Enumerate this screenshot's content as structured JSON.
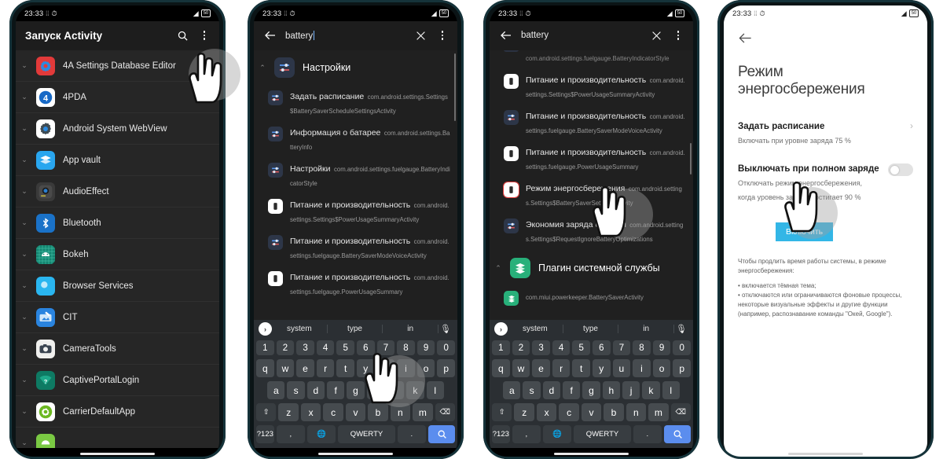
{
  "statusbar": {
    "time": "23:33",
    "vibrate_icon": "vibrate-icon",
    "alarm_icon": "alarm-icon",
    "signal_icon": "signal-icon",
    "battery_text": "50"
  },
  "panel1": {
    "title": "Запуск Activity",
    "search_icon": "search-icon",
    "overflow_icon": "overflow-menu-icon",
    "apps": [
      {
        "label": "4A Settings Database Editor",
        "icon": "gear-app-icon"
      },
      {
        "label": "4PDA",
        "icon": "4pda-app-icon"
      },
      {
        "label": "Android System WebView",
        "icon": "webview-app-icon"
      },
      {
        "label": "App vault",
        "icon": "app-vault-icon"
      },
      {
        "label": "AudioEffect",
        "icon": "audio-effect-icon"
      },
      {
        "label": "Bluetooth",
        "icon": "bluetooth-icon"
      },
      {
        "label": "Bokeh",
        "icon": "bokeh-icon"
      },
      {
        "label": "Browser Services",
        "icon": "browser-services-icon"
      },
      {
        "label": "CIT",
        "icon": "cit-icon"
      },
      {
        "label": "CameraTools",
        "icon": "camera-tools-icon"
      },
      {
        "label": "CaptivePortalLogin",
        "icon": "captive-portal-icon"
      },
      {
        "label": "CarrierDefaultApp",
        "icon": "carrier-default-icon"
      }
    ]
  },
  "panel2": {
    "back_icon": "back-arrow-icon",
    "query": "battery",
    "clear_icon": "clear-x-icon",
    "overflow_icon": "overflow-menu-icon",
    "group": {
      "label": "Настройки",
      "icon": "settings-app-icon"
    },
    "results": [
      {
        "name": "Задать расписание",
        "pkg": "com.android.settings.Settings$BatterySaverScheduleSettingsActivity",
        "icon": "settings-sliders-icon"
      },
      {
        "name": "Информация о батарее",
        "pkg": "com.android.settings.BatteryInfo",
        "icon": "settings-sliders-icon"
      },
      {
        "name": "Настройки",
        "pkg": "com.android.settings.fuelgauge.BatteryIndicatorStyle",
        "icon": "settings-sliders-icon"
      },
      {
        "name": "Питание и производительность",
        "pkg": "com.android.settings.Settings$PowerUsageSummaryActivity",
        "icon": "battery-icon"
      },
      {
        "name": "Питание и производительность",
        "pkg": "com.android.settings.fuelgauge.BatterySaverModeVoiceActivity",
        "icon": "settings-sliders-icon"
      },
      {
        "name": "Питание и производительность",
        "pkg": "com.android.settings.fuelgauge.PowerUsageSummary",
        "icon": "battery-icon"
      }
    ]
  },
  "panel3": {
    "back_icon": "back-arrow-icon",
    "query": "battery",
    "clear_icon": "clear-x-icon",
    "overflow_icon": "overflow-menu-icon",
    "top_partial_pkg": "com.android.settings.fuelgauge.BatteryIndicatorStyle",
    "results": [
      {
        "name": "Питание и производительность",
        "pkg": "com.android.settings.Settings$PowerUsageSummaryActivity",
        "icon": "battery-icon",
        "highlight": false
      },
      {
        "name": "Питание и производительность",
        "pkg": "com.android.settings.fuelgauge.BatterySaverModeVoiceActivity",
        "icon": "settings-sliders-icon",
        "highlight": false
      },
      {
        "name": "Питание и производительность",
        "pkg": "com.android.settings.fuelgauge.PowerUsageSummary",
        "icon": "battery-icon",
        "highlight": false
      },
      {
        "name": "Режим энергосбережения",
        "pkg": "com.android.settings.Settings$BatterySaverSettingsActivity",
        "icon": "battery-icon",
        "highlight": true
      },
      {
        "name": "Экономия заряда батареи",
        "pkg": "com.android.settings.Settings$RequestIgnoreBatteryOptimizations",
        "icon": "settings-sliders-icon",
        "highlight": false
      }
    ],
    "group2": {
      "label": "Плагин системной службы",
      "icon": "plugin-stack-icon"
    },
    "group2_item_pkg": "com.miui.powerkeeper.BatterySaverActivity"
  },
  "panel4": {
    "back_icon": "back-arrow-icon",
    "title": "Режим энергосбережения",
    "schedule": {
      "title": "Задать расписание",
      "subtitle": "Включать при уровне заряда 75 %",
      "chevron_icon": "chevron-right-icon"
    },
    "full_charge": {
      "title": "Выключать при полном заряде",
      "subtitle": "Отключать режим энергосбережения, когда уровень заряда достигает 90 %",
      "toggle_icon": "toggle-off-icon"
    },
    "enable_button": "Включить",
    "description_lines": [
      "Чтобы продлить время работы системы, в режиме энергосбережения:",
      "• включается тёмная тема;",
      "• отключаются или ограничиваются фоновые процессы, некоторые визуальные эффекты и другие функции (например, распознавание команды \"Окей, Google\")."
    ]
  },
  "keyboard": {
    "suggestions": [
      "system",
      "type",
      "in"
    ],
    "expand_icon": "expand-chevron-icon",
    "mic_icon": "mic-icon",
    "numbers": [
      "1",
      "2",
      "3",
      "4",
      "5",
      "6",
      "7",
      "8",
      "9",
      "0"
    ],
    "row1": [
      "q",
      "w",
      "e",
      "r",
      "t",
      "y",
      "u",
      "i",
      "o",
      "p"
    ],
    "row2": [
      "a",
      "s",
      "d",
      "f",
      "g",
      "h",
      "j",
      "k",
      "l"
    ],
    "row3": [
      "z",
      "x",
      "c",
      "v",
      "b",
      "n",
      "m"
    ],
    "shift_icon": "shift-icon",
    "backspace_icon": "backspace-icon",
    "symbols_key": "?123",
    "emoji_key": ",",
    "globe_icon": "globe-icon",
    "space_key": "QWERTY",
    "period_key": ".",
    "search_icon": "search-key-icon"
  }
}
